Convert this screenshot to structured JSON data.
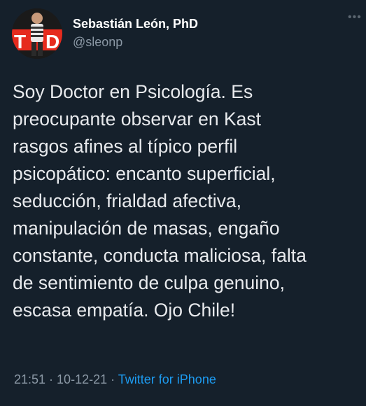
{
  "author": {
    "display_name": "Sebastián León, PhD",
    "handle": "@sleonp",
    "avatar_icon": "profile-photo-ted-logo"
  },
  "more_icon": "ellipsis-icon",
  "tweet": {
    "lines": [
      "Soy Doctor en Psicología. Es",
      "preocupante observar en Kast",
      "rasgos afines al típico perfil",
      "psicopático: encanto superficial,",
      "seducción, frialdad afectiva,",
      "manipulación de masas, engaño",
      "constante, conducta maliciosa, falta",
      "de sentimiento de culpa genuino,",
      "escasa empatía. Ojo Chile!"
    ]
  },
  "meta": {
    "time": "21:51",
    "date": "10-12-21",
    "source": "Twitter for iPhone",
    "separator": " · "
  },
  "colors": {
    "background": "#15202b",
    "text": "#e8eaed",
    "secondary": "#8b98a5",
    "link": "#1d9bf0"
  }
}
